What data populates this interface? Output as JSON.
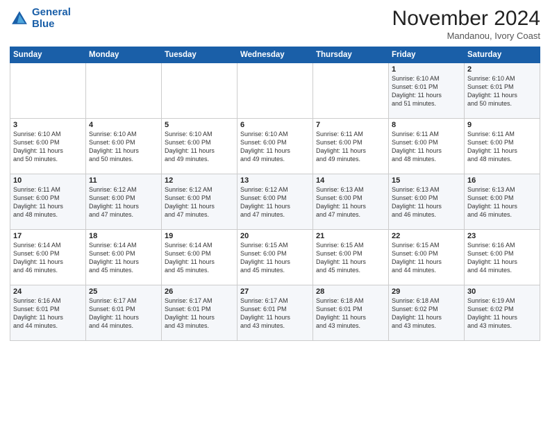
{
  "logo": {
    "line1": "General",
    "line2": "Blue"
  },
  "header": {
    "month": "November 2024",
    "location": "Mandanou, Ivory Coast"
  },
  "weekdays": [
    "Sunday",
    "Monday",
    "Tuesday",
    "Wednesday",
    "Thursday",
    "Friday",
    "Saturday"
  ],
  "weeks": [
    [
      {
        "day": "",
        "info": ""
      },
      {
        "day": "",
        "info": ""
      },
      {
        "day": "",
        "info": ""
      },
      {
        "day": "",
        "info": ""
      },
      {
        "day": "",
        "info": ""
      },
      {
        "day": "1",
        "info": "Sunrise: 6:10 AM\nSunset: 6:01 PM\nDaylight: 11 hours\nand 51 minutes."
      },
      {
        "day": "2",
        "info": "Sunrise: 6:10 AM\nSunset: 6:01 PM\nDaylight: 11 hours\nand 50 minutes."
      }
    ],
    [
      {
        "day": "3",
        "info": "Sunrise: 6:10 AM\nSunset: 6:00 PM\nDaylight: 11 hours\nand 50 minutes."
      },
      {
        "day": "4",
        "info": "Sunrise: 6:10 AM\nSunset: 6:00 PM\nDaylight: 11 hours\nand 50 minutes."
      },
      {
        "day": "5",
        "info": "Sunrise: 6:10 AM\nSunset: 6:00 PM\nDaylight: 11 hours\nand 49 minutes."
      },
      {
        "day": "6",
        "info": "Sunrise: 6:10 AM\nSunset: 6:00 PM\nDaylight: 11 hours\nand 49 minutes."
      },
      {
        "day": "7",
        "info": "Sunrise: 6:11 AM\nSunset: 6:00 PM\nDaylight: 11 hours\nand 49 minutes."
      },
      {
        "day": "8",
        "info": "Sunrise: 6:11 AM\nSunset: 6:00 PM\nDaylight: 11 hours\nand 48 minutes."
      },
      {
        "day": "9",
        "info": "Sunrise: 6:11 AM\nSunset: 6:00 PM\nDaylight: 11 hours\nand 48 minutes."
      }
    ],
    [
      {
        "day": "10",
        "info": "Sunrise: 6:11 AM\nSunset: 6:00 PM\nDaylight: 11 hours\nand 48 minutes."
      },
      {
        "day": "11",
        "info": "Sunrise: 6:12 AM\nSunset: 6:00 PM\nDaylight: 11 hours\nand 47 minutes."
      },
      {
        "day": "12",
        "info": "Sunrise: 6:12 AM\nSunset: 6:00 PM\nDaylight: 11 hours\nand 47 minutes."
      },
      {
        "day": "13",
        "info": "Sunrise: 6:12 AM\nSunset: 6:00 PM\nDaylight: 11 hours\nand 47 minutes."
      },
      {
        "day": "14",
        "info": "Sunrise: 6:13 AM\nSunset: 6:00 PM\nDaylight: 11 hours\nand 47 minutes."
      },
      {
        "day": "15",
        "info": "Sunrise: 6:13 AM\nSunset: 6:00 PM\nDaylight: 11 hours\nand 46 minutes."
      },
      {
        "day": "16",
        "info": "Sunrise: 6:13 AM\nSunset: 6:00 PM\nDaylight: 11 hours\nand 46 minutes."
      }
    ],
    [
      {
        "day": "17",
        "info": "Sunrise: 6:14 AM\nSunset: 6:00 PM\nDaylight: 11 hours\nand 46 minutes."
      },
      {
        "day": "18",
        "info": "Sunrise: 6:14 AM\nSunset: 6:00 PM\nDaylight: 11 hours\nand 45 minutes."
      },
      {
        "day": "19",
        "info": "Sunrise: 6:14 AM\nSunset: 6:00 PM\nDaylight: 11 hours\nand 45 minutes."
      },
      {
        "day": "20",
        "info": "Sunrise: 6:15 AM\nSunset: 6:00 PM\nDaylight: 11 hours\nand 45 minutes."
      },
      {
        "day": "21",
        "info": "Sunrise: 6:15 AM\nSunset: 6:00 PM\nDaylight: 11 hours\nand 45 minutes."
      },
      {
        "day": "22",
        "info": "Sunrise: 6:15 AM\nSunset: 6:00 PM\nDaylight: 11 hours\nand 44 minutes."
      },
      {
        "day": "23",
        "info": "Sunrise: 6:16 AM\nSunset: 6:00 PM\nDaylight: 11 hours\nand 44 minutes."
      }
    ],
    [
      {
        "day": "24",
        "info": "Sunrise: 6:16 AM\nSunset: 6:01 PM\nDaylight: 11 hours\nand 44 minutes."
      },
      {
        "day": "25",
        "info": "Sunrise: 6:17 AM\nSunset: 6:01 PM\nDaylight: 11 hours\nand 44 minutes."
      },
      {
        "day": "26",
        "info": "Sunrise: 6:17 AM\nSunset: 6:01 PM\nDaylight: 11 hours\nand 43 minutes."
      },
      {
        "day": "27",
        "info": "Sunrise: 6:17 AM\nSunset: 6:01 PM\nDaylight: 11 hours\nand 43 minutes."
      },
      {
        "day": "28",
        "info": "Sunrise: 6:18 AM\nSunset: 6:01 PM\nDaylight: 11 hours\nand 43 minutes."
      },
      {
        "day": "29",
        "info": "Sunrise: 6:18 AM\nSunset: 6:02 PM\nDaylight: 11 hours\nand 43 minutes."
      },
      {
        "day": "30",
        "info": "Sunrise: 6:19 AM\nSunset: 6:02 PM\nDaylight: 11 hours\nand 43 minutes."
      }
    ]
  ]
}
